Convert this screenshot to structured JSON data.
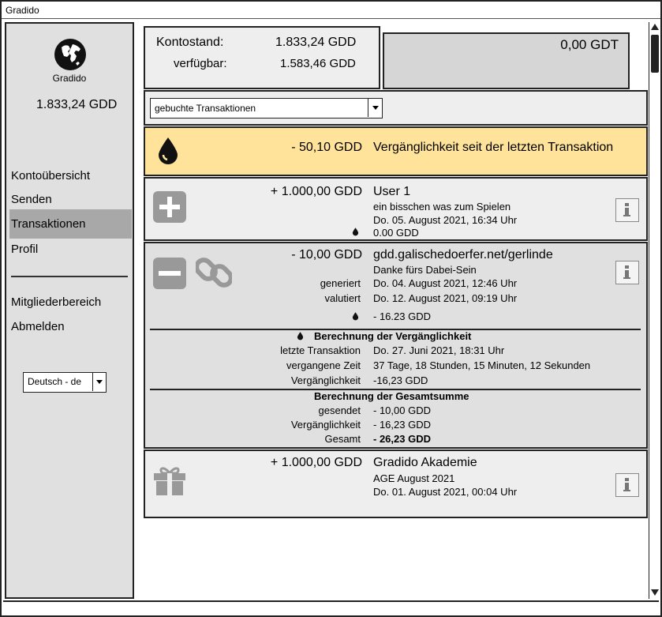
{
  "app": {
    "title": "Gradido"
  },
  "sidebar": {
    "brand": "Gradido",
    "balance": "1.833,24 GDD",
    "nav": {
      "overview": "Kontoübersicht",
      "send": "Senden",
      "transactions": "Transaktionen",
      "profile": "Profil",
      "members": "Mitgliederbereich",
      "logout": "Abmelden"
    },
    "language": "Deutsch - de"
  },
  "balance": {
    "label": "Kontostand:",
    "value": "1.833,24 GDD",
    "available_label": "verfügbar:",
    "available_value": "1.583,46 GDD",
    "gdt": "0,00 GDT"
  },
  "filter": {
    "selected": "gebuchte Transaktionen"
  },
  "decay": {
    "amount": "- 50,10 GDD",
    "text": "Vergänglichkeit seit der letzten Transaktion"
  },
  "tx1": {
    "amount": "+ 1.000,00 GDD",
    "name": "User 1",
    "memo": "ein bisschen was zum Spielen",
    "date": "Do. 05. August 2021, 16:34 Uhr",
    "decay": "0.00 GDD"
  },
  "tx2": {
    "amount": "- 10,00 GDD",
    "name": "gdd.galischedoerfer.net/gerlinde",
    "memo": "Danke fürs Dabei-Sein",
    "generated_label": "generiert",
    "generated": "Do. 04. August 2021, 12:46 Uhr",
    "validated_label": "valutiert",
    "validated": "Do. 12. August 2021, 09:19 Uhr",
    "decay": "- 16.23 GDD",
    "calc_title": "Berechnung der Vergänglichkeit",
    "last_tx_label": "letzte Transaktion",
    "last_tx": "Do. 27. Juni 2021, 18:31 Uhr",
    "elapsed_label": "vergangene Zeit",
    "elapsed": "37 Tage, 18 Stunden, 15 Minuten, 12 Sekunden",
    "decay_label": "Vergänglichkeit",
    "decay_value": "-16,23 GDD",
    "total_title": "Berechnung der Gesamtsumme",
    "sent_label": "gesendet",
    "sent": "- 10,00 GDD",
    "decay2_label": "Vergänglichkeit",
    "decay2": "- 16,23 GDD",
    "total_label": "Gesamt",
    "total": "- 26,23 GDD"
  },
  "tx3": {
    "amount": "+ 1.000,00 GDD",
    "name": "Gradido Akademie",
    "memo": "AGE August 2021",
    "date": "Do. 01. August 2021, 00:04 Uhr"
  },
  "icons": {
    "globe": "globe-icon",
    "drop": "drop-icon",
    "plus": "plus-icon",
    "minus": "minus-icon",
    "link": "link-icon",
    "gift": "gift-icon",
    "info": "info-icon"
  },
  "colors": {
    "decay_bg": "#ffe39a",
    "active_nav": "#a8a8a8",
    "icon_gray": "#999999"
  }
}
